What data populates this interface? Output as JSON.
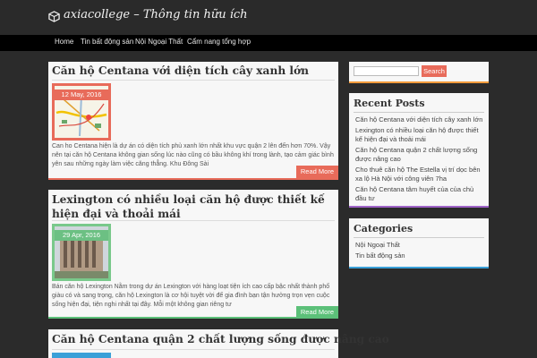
{
  "site": {
    "title": "axiacollege – Thông tin hữu ích",
    "logo_icon": "cube-icon"
  },
  "nav": {
    "items": [
      "Home",
      "Tin bất động sản",
      "Nội Ngoại Thất",
      "Cẩm nang tổng hợp"
    ]
  },
  "posts": [
    {
      "title": "Căn hộ Centana với diện tích cây xanh lớn",
      "date": "12 May, 2016",
      "excerpt": "Can ho Centana hiện là dự án có diện tích phủ xanh lớn nhất khu vực quận 2 lên đến hơn 70%. Vậy nên tại căn hộ Centana không gian sống lúc nào cũng có bầu không khí trong lành, tạo cảm giác bình yên sau những ngày làm việc căng thẳng. Khu Đông Sài",
      "read_more": "Read More",
      "accent": "#e86b5a"
    },
    {
      "title": "Lexington có nhiều loại căn hộ được thiết kế hiện đại và thoải mái",
      "date": "29 Apr, 2016",
      "excerpt": "Bán căn hộ Lexington Nằm trong dự án Lexington với hàng loạt tiện ích cao cấp bậc nhất thành phố giàu có và sang trọng, căn hộ Lexington là cơ hội tuyệt vời để gia đình bạn tận hưởng trọn vẹn cuộc sống hiện đại, tiện nghi nhất tại đây. Mỗi một không gian riêng tư",
      "read_more": "Read More",
      "accent": "#5cc079"
    },
    {
      "title": "Căn hộ Centana quận 2 chất lượng sống được nâng cao"
    }
  ],
  "search": {
    "button": "Search",
    "placeholder": ""
  },
  "recent_posts": {
    "title": "Recent Posts",
    "items": [
      "Căn hộ Centana với diện tích cây xanh lớn",
      "Lexington có nhiều loại căn hộ được thiết kế hiện đại và thoải mái",
      "Căn hộ Centana quận 2 chất lượng sống được nâng cao",
      "Cho thuê căn hộ The Estella vị trí dọc bên xa lộ Hà Nội với công viên 7ha",
      "Căn hộ Centana tâm huyết của của chủ đầu tư"
    ]
  },
  "categories": {
    "title": "Categories",
    "items": [
      "Nội Ngoại Thất",
      "Tin bất động sản"
    ]
  },
  "colors": {
    "red": "#e86b5a",
    "green": "#5cc079",
    "orange": "#f39c3c",
    "purple": "#a065c9",
    "blue": "#3aa0d8"
  }
}
